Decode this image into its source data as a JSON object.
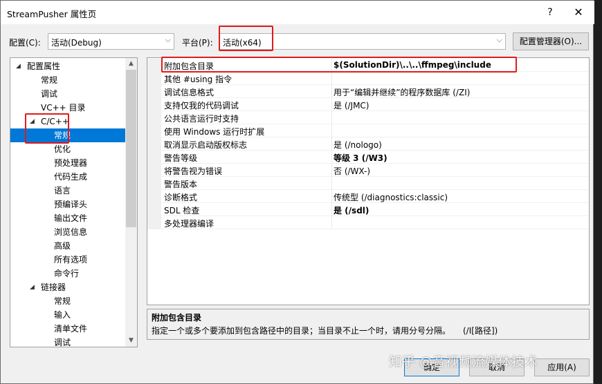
{
  "window": {
    "title": "StreamPusher 属性页",
    "help": "?",
    "close": "✕"
  },
  "config": {
    "label": "配置(C):",
    "value": "活动(Debug)"
  },
  "platform": {
    "label": "平台(P):",
    "value": "活动(x64)"
  },
  "config_manager": "配置管理器(O)...",
  "tree": [
    {
      "label": "配置属性",
      "level": 0,
      "expander": "◢"
    },
    {
      "label": "常规",
      "level": 1
    },
    {
      "label": "调试",
      "level": 1
    },
    {
      "label": "VC++ 目录",
      "level": 1
    },
    {
      "label": "C/C++",
      "level": 1,
      "expander": "◢"
    },
    {
      "label": "常规",
      "level": 2,
      "selected": true
    },
    {
      "label": "优化",
      "level": 2
    },
    {
      "label": "预处理器",
      "level": 2
    },
    {
      "label": "代码生成",
      "level": 2
    },
    {
      "label": "语言",
      "level": 2
    },
    {
      "label": "预编译头",
      "level": 2
    },
    {
      "label": "输出文件",
      "level": 2
    },
    {
      "label": "浏览信息",
      "level": 2
    },
    {
      "label": "高级",
      "level": 2
    },
    {
      "label": "所有选项",
      "level": 2
    },
    {
      "label": "命令行",
      "level": 2
    },
    {
      "label": "链接器",
      "level": 1,
      "expander": "◢"
    },
    {
      "label": "常规",
      "level": 2
    },
    {
      "label": "输入",
      "level": 2
    },
    {
      "label": "清单文件",
      "level": 2
    },
    {
      "label": "调试",
      "level": 2
    }
  ],
  "properties": [
    {
      "name": "附加包含目录",
      "value": "$(SolutionDir)\\..\\..\\ffmpeg\\include",
      "bold": true
    },
    {
      "name": "其他 #using 指令",
      "value": "",
      "bold": false
    },
    {
      "name": "调试信息格式",
      "value": "用于“编辑并继续”的程序数据库 (/ZI)",
      "bold": false
    },
    {
      "name": "支持仅我的代码调试",
      "value": "是 (/JMC)",
      "bold": false
    },
    {
      "name": "公共语言运行时支持",
      "value": "",
      "bold": false
    },
    {
      "name": "使用 Windows 运行时扩展",
      "value": "",
      "bold": false
    },
    {
      "name": "取消显示启动版权标志",
      "value": "是 (/nologo)",
      "bold": false
    },
    {
      "name": "警告等级",
      "value": "等级 3 (/W3)",
      "bold": true
    },
    {
      "name": "将警告视为错误",
      "value": "否 (/WX-)",
      "bold": false
    },
    {
      "name": "警告版本",
      "value": "",
      "bold": false
    },
    {
      "name": "诊断格式",
      "value": "传统型 (/diagnostics:classic)",
      "bold": false
    },
    {
      "name": "SDL 检查",
      "value": "是 (/sdl)",
      "bold": true
    },
    {
      "name": "多处理器编译",
      "value": "",
      "bold": false
    }
  ],
  "description": {
    "title": "附加包含目录",
    "text": "指定一个或多个要添加到包含路径中的目录；当目录不止一个时，请用分号分隔。　　(/I[路径])"
  },
  "buttons": {
    "ok": "确定",
    "cancel": "取消",
    "apply": "应用(A)"
  },
  "watermark": "知乎 @音视频流媒体技术",
  "colors": {
    "selection": "#0078d7",
    "highlight": "#e01a1a"
  }
}
